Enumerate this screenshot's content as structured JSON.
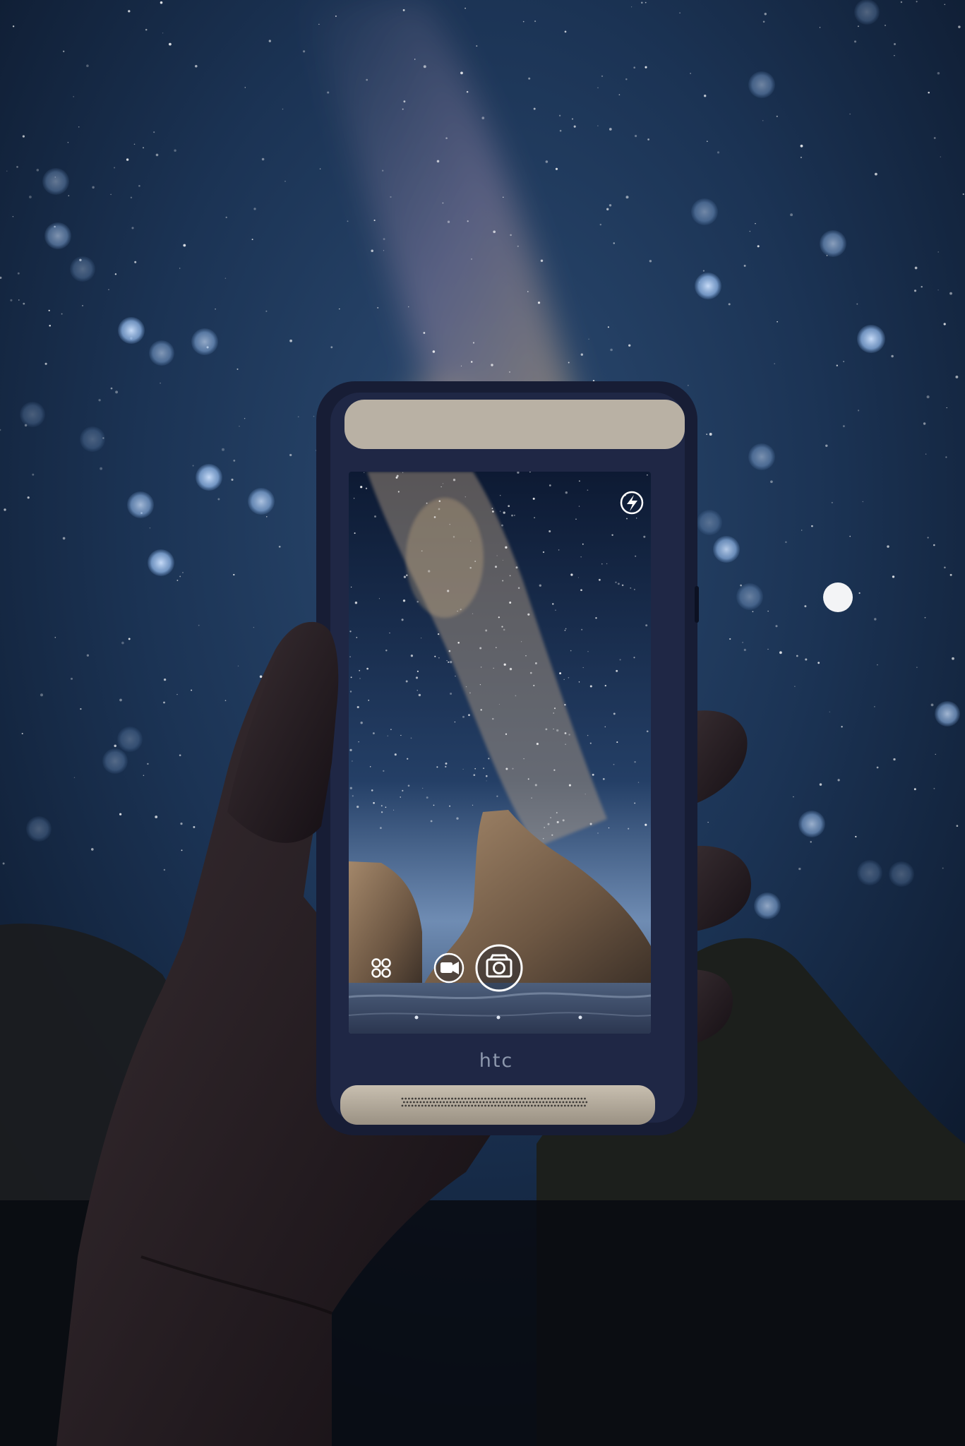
{
  "phone": {
    "brand": "htc"
  },
  "camera_ui": {
    "icons": [
      "flash-icon",
      "modes-grid-icon",
      "video-icon",
      "camera-shutter-icon"
    ],
    "page_indicator_count": 3
  },
  "colors": {
    "sky_top": "#0b1530",
    "sky_mid": "#1d3a5f",
    "bokeh": "#9fc4ef",
    "phone_body": "#171d35",
    "accent_ui": "#ffffff"
  }
}
